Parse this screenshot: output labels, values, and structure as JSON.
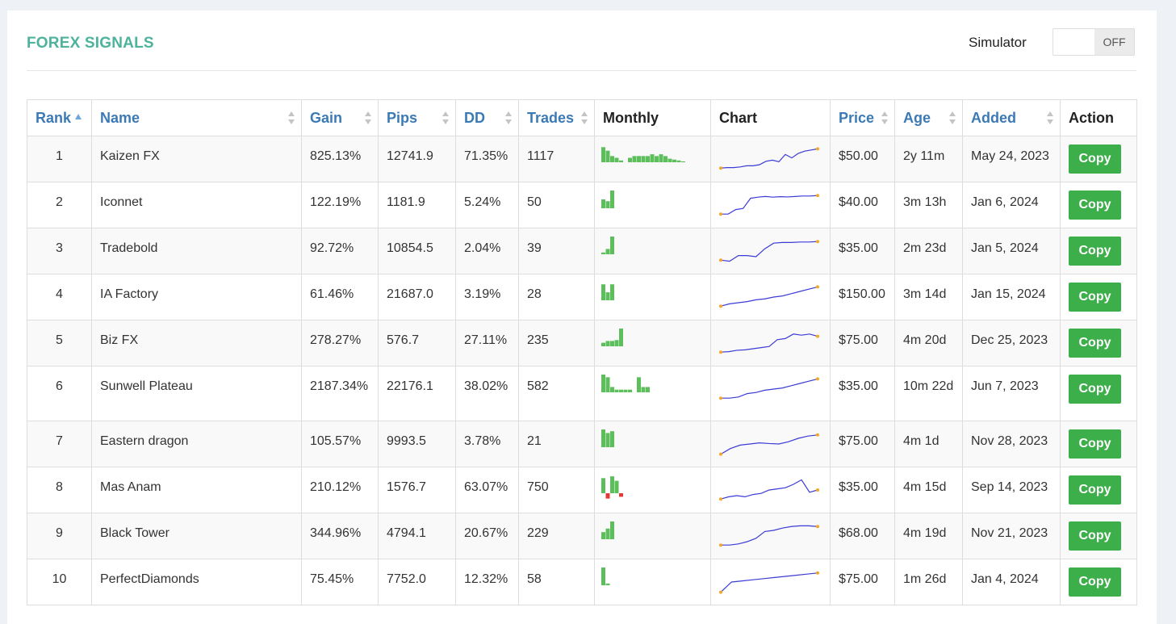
{
  "header": {
    "title": "FOREX SIGNALS",
    "simulator_label": "Simulator",
    "simulator_state": "OFF"
  },
  "columns": {
    "rank": "Rank",
    "name": "Name",
    "gain": "Gain",
    "pips": "Pips",
    "dd": "DD",
    "trades": "Trades",
    "monthly": "Monthly",
    "chart": "Chart",
    "price": "Price",
    "age": "Age",
    "added": "Added",
    "action": "Action"
  },
  "colors": {
    "accent": "#4db39d",
    "link": "#3b7ab5",
    "gain": "#18a24a",
    "button": "#3cae4a",
    "bar_up": "#5cbf5c",
    "bar_down": "#e53935",
    "line": "#3b3bd6",
    "dot": "#f5a623"
  },
  "copy_label": "Copy",
  "rows": [
    {
      "rank": "1",
      "name": "Kaizen FX",
      "gain": "825.13%",
      "pips": "12741.9",
      "dd": "71.35%",
      "trades": "1117",
      "price": "$50.00",
      "age": "2y 11m",
      "added": "May 24, 2023",
      "monthly": [
        0.85,
        0.65,
        0.35,
        0.25,
        0.1,
        0,
        0.25,
        0.35,
        0.35,
        0.35,
        0.35,
        0.45,
        0.35,
        0.45,
        0.35,
        0.2,
        0.15,
        0.1,
        0.05
      ],
      "chart": [
        0.1,
        0.12,
        0.12,
        0.15,
        0.2,
        0.2,
        0.25,
        0.4,
        0.45,
        0.38,
        0.7,
        0.55,
        0.75,
        0.85,
        0.9,
        0.95
      ]
    },
    {
      "rank": "2",
      "name": "Iconnet",
      "gain": "122.19%",
      "pips": "1181.9",
      "dd": "5.24%",
      "trades": "50",
      "price": "$40.00",
      "age": "3m 13h",
      "added": "Jan 6, 2024",
      "monthly": [
        0.5,
        0.4,
        1.0
      ],
      "chart": [
        0.1,
        0.1,
        0.3,
        0.35,
        0.8,
        0.85,
        0.88,
        0.85,
        0.87,
        0.86,
        0.88,
        0.9,
        0.9,
        0.92
      ]
    },
    {
      "rank": "3",
      "name": "Tradebold",
      "gain": "92.72%",
      "pips": "10854.5",
      "dd": "2.04%",
      "trades": "39",
      "price": "$35.00",
      "age": "2m 23d",
      "added": "Jan 5, 2024",
      "monthly": [
        0.1,
        0.3,
        1.0
      ],
      "chart": [
        0.1,
        0.05,
        0.3,
        0.3,
        0.25,
        0.6,
        0.85,
        0.88,
        0.88,
        0.9,
        0.9,
        0.92
      ]
    },
    {
      "rank": "4",
      "name": "IA Factory",
      "gain": "61.46%",
      "pips": "21687.0",
      "dd": "3.19%",
      "trades": "28",
      "price": "$150.00",
      "age": "3m 14d",
      "added": "Jan 15, 2024",
      "monthly": [
        0.9,
        0.45,
        0.9
      ],
      "chart": [
        0.1,
        0.2,
        0.25,
        0.3,
        0.38,
        0.42,
        0.5,
        0.55,
        0.65,
        0.75,
        0.85,
        0.95
      ]
    },
    {
      "rank": "5",
      "name": "Biz FX",
      "gain": "278.27%",
      "pips": "576.7",
      "dd": "27.11%",
      "trades": "235",
      "price": "$75.00",
      "age": "4m 20d",
      "added": "Dec 25, 2023",
      "monthly": [
        0.2,
        0.3,
        0.3,
        0.35,
        1.0
      ],
      "chart": [
        0.1,
        0.12,
        0.18,
        0.2,
        0.25,
        0.3,
        0.35,
        0.65,
        0.7,
        0.9,
        0.85,
        0.9,
        0.8
      ]
    },
    {
      "rank": "6",
      "name": "Sunwell Plateau",
      "gain": "2187.34%",
      "pips": "22176.1",
      "dd": "38.02%",
      "trades": "582",
      "price": "$35.00",
      "age": "10m 22d",
      "added": "Jun 7, 2023",
      "monthly": [
        1.0,
        0.85,
        0.3,
        0.15,
        0.15,
        0.15,
        0.15,
        0,
        0.85,
        0.3,
        0.3
      ],
      "chart": [
        0.1,
        0.1,
        0.15,
        0.3,
        0.35,
        0.45,
        0.5,
        0.55,
        0.65,
        0.75,
        0.85,
        0.95
      ]
    },
    {
      "rank": "7",
      "name": "Eastern dragon",
      "gain": "105.57%",
      "pips": "9993.5",
      "dd": "3.78%",
      "trades": "21",
      "price": "$75.00",
      "age": "4m 1d",
      "added": "Nov 28, 2023",
      "monthly": [
        1.0,
        0.8,
        0.9
      ],
      "chart": [
        0.05,
        0.3,
        0.45,
        0.5,
        0.55,
        0.52,
        0.5,
        0.6,
        0.75,
        0.85,
        0.9
      ]
    },
    {
      "rank": "8",
      "name": "Mas Anam",
      "gain": "210.12%",
      "pips": "1576.7",
      "dd": "63.07%",
      "trades": "750",
      "price": "$35.00",
      "age": "4m 15d",
      "added": "Sep 14, 2023",
      "monthly": [
        0.85,
        -0.3,
        0.95,
        0.7,
        -0.2
      ],
      "chart": [
        0.1,
        0.2,
        0.25,
        0.2,
        0.3,
        0.35,
        0.5,
        0.55,
        0.6,
        0.75,
        0.95,
        0.4,
        0.5
      ]
    },
    {
      "rank": "9",
      "name": "Black Tower",
      "gain": "344.96%",
      "pips": "4794.1",
      "dd": "20.67%",
      "trades": "229",
      "price": "$68.00",
      "age": "4m 19d",
      "added": "Nov 21, 2023",
      "monthly": [
        0.4,
        0.6,
        1.0
      ],
      "chart": [
        0.1,
        0.1,
        0.15,
        0.25,
        0.4,
        0.7,
        0.75,
        0.85,
        0.92,
        0.95,
        0.95,
        0.92
      ]
    },
    {
      "rank": "10",
      "name": "PerfectDiamonds",
      "gain": "75.45%",
      "pips": "7752.0",
      "dd": "12.32%",
      "trades": "58",
      "price": "$75.00",
      "age": "1m 26d",
      "added": "Jan 4, 2024",
      "monthly": [
        1.0,
        0.1
      ],
      "chart": [
        0.05,
        0.5,
        0.55,
        0.6,
        0.65,
        0.7,
        0.75,
        0.8,
        0.85,
        0.9
      ]
    }
  ]
}
